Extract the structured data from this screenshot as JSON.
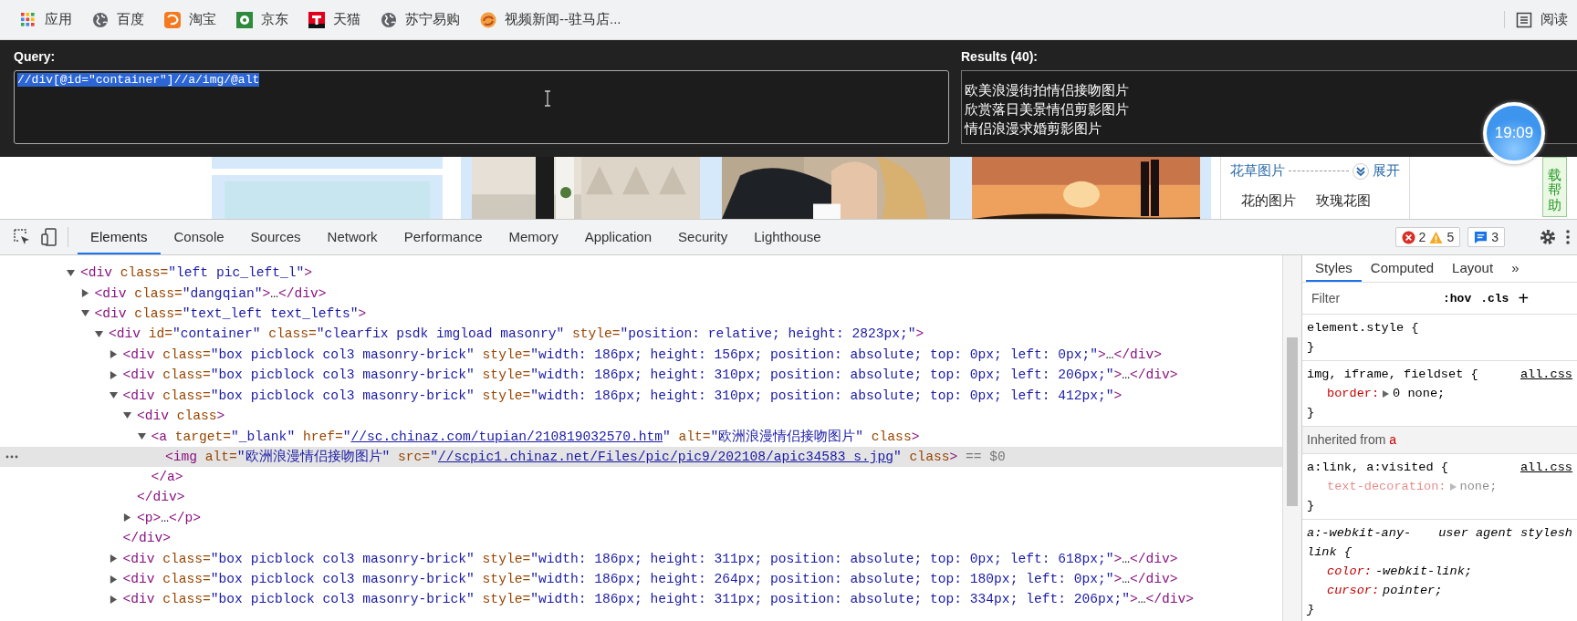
{
  "bookmarks": [
    {
      "kind": "apps",
      "label": "应用"
    },
    {
      "kind": "globe",
      "label": "百度"
    },
    {
      "kind": "taobao",
      "label": "淘宝"
    },
    {
      "kind": "jd",
      "label": "京东"
    },
    {
      "kind": "tmall",
      "label": "天猫"
    },
    {
      "kind": "globe",
      "label": "苏宁易购"
    },
    {
      "kind": "video",
      "label": "视频新闻--驻马店..."
    }
  ],
  "reading_list": {
    "label": "阅读"
  },
  "xpath_helper": {
    "query_label": "Query:",
    "query": {
      "value": "//div[@id=\"container\"]//a/img/@alt",
      "highlighted": true
    },
    "results_label": "Results (40):",
    "results": [
      "欧美浪漫街拍情侣接吻图片",
      "欣赏落日美景情侣剪影图片",
      "情侣浪漫求婚剪影图片"
    ]
  },
  "clock": "19:09",
  "page": {
    "sidebar": {
      "heading": "花草图片",
      "expand": "展开",
      "links": [
        "花的图片",
        "玫瑰花图"
      ]
    },
    "help_button": "载帮助"
  },
  "devtools": {
    "tabs": [
      {
        "label": "Elements",
        "selected": true
      },
      {
        "label": "Console",
        "selected": false
      },
      {
        "label": "Sources",
        "selected": false
      },
      {
        "label": "Network",
        "selected": false
      },
      {
        "label": "Performance",
        "selected": false
      },
      {
        "label": "Memory",
        "selected": false
      },
      {
        "label": "Application",
        "selected": false
      },
      {
        "label": "Security",
        "selected": false
      },
      {
        "label": "Lighthouse",
        "selected": false
      }
    ],
    "issues": {
      "errors": "2",
      "warnings": "5",
      "messages": "3"
    },
    "tree": [
      {
        "expanded": true,
        "selected": false,
        "line": [
          {
            "kind": "tag",
            "text": "<div"
          },
          {
            "kind": "attr",
            "text": " class="
          },
          {
            "kind": "value",
            "text": "\"left pic_left_l\""
          },
          {
            "kind": "tag",
            "text": ">"
          }
        ],
        "children": [
          {
            "expanded": false,
            "selected": false,
            "line": [
              {
                "kind": "tag",
                "text": "<div"
              },
              {
                "kind": "attr",
                "text": " class="
              },
              {
                "kind": "value",
                "text": "\"dangqian\""
              },
              {
                "kind": "tag",
                "text": ">"
              },
              {
                "kind": "plain",
                "text": "…"
              },
              {
                "kind": "tag",
                "text": "</div>"
              }
            ]
          },
          {
            "expanded": true,
            "selected": false,
            "line": [
              {
                "kind": "tag",
                "text": "<div"
              },
              {
                "kind": "attr",
                "text": " class="
              },
              {
                "kind": "value",
                "text": "\"text_left text_lefts\""
              },
              {
                "kind": "tag",
                "text": ">"
              }
            ],
            "children": [
              {
                "expanded": true,
                "selected": false,
                "line": [
                  {
                    "kind": "tag",
                    "text": "<div"
                  },
                  {
                    "kind": "attr",
                    "text": " id="
                  },
                  {
                    "kind": "value",
                    "text": "\"container\""
                  },
                  {
                    "kind": "attr",
                    "text": " class="
                  },
                  {
                    "kind": "value",
                    "text": "\"clearfix psdk imgload masonry\""
                  },
                  {
                    "kind": "attr",
                    "text": " style="
                  },
                  {
                    "kind": "value",
                    "text": "\"position: relative; height: 2823px;\""
                  },
                  {
                    "kind": "tag",
                    "text": ">"
                  }
                ],
                "children": [
                  {
                    "expanded": false,
                    "selected": false,
                    "line": [
                      {
                        "kind": "tag",
                        "text": "<div"
                      },
                      {
                        "kind": "attr",
                        "text": " class="
                      },
                      {
                        "kind": "value",
                        "text": "\"box picblock col3 masonry-brick\""
                      },
                      {
                        "kind": "attr",
                        "text": " style="
                      },
                      {
                        "kind": "value",
                        "text": "\"width: 186px; height: 156px; position: absolute; top: 0px; left: 0px;\""
                      },
                      {
                        "kind": "tag",
                        "text": ">"
                      },
                      {
                        "kind": "plain",
                        "text": "…"
                      },
                      {
                        "kind": "tag",
                        "text": "</div>"
                      }
                    ]
                  },
                  {
                    "expanded": false,
                    "selected": false,
                    "line": [
                      {
                        "kind": "tag",
                        "text": "<div"
                      },
                      {
                        "kind": "attr",
                        "text": " class="
                      },
                      {
                        "kind": "value",
                        "text": "\"box picblock col3 masonry-brick\""
                      },
                      {
                        "kind": "attr",
                        "text": " style="
                      },
                      {
                        "kind": "value",
                        "text": "\"width: 186px; height: 310px; position: absolute; top: 0px; left: 206px;\""
                      },
                      {
                        "kind": "tag",
                        "text": ">"
                      },
                      {
                        "kind": "plain",
                        "text": "…"
                      },
                      {
                        "kind": "tag",
                        "text": "</div>"
                      }
                    ]
                  },
                  {
                    "expanded": true,
                    "selected": false,
                    "line": [
                      {
                        "kind": "tag",
                        "text": "<div"
                      },
                      {
                        "kind": "attr",
                        "text": " class="
                      },
                      {
                        "kind": "value",
                        "text": "\"box picblock col3 masonry-brick\""
                      },
                      {
                        "kind": "attr",
                        "text": " style="
                      },
                      {
                        "kind": "value",
                        "text": "\"width: 186px; height: 310px; position: absolute; top: 0px; left: 412px;\""
                      },
                      {
                        "kind": "tag",
                        "text": ">"
                      }
                    ],
                    "end": [
                      {
                        "kind": "tag",
                        "text": "</div>"
                      }
                    ],
                    "children": [
                      {
                        "expanded": true,
                        "selected": false,
                        "line": [
                          {
                            "kind": "tag",
                            "text": "<div"
                          },
                          {
                            "kind": "attr",
                            "text": " class"
                          },
                          {
                            "kind": "tag",
                            "text": ">"
                          }
                        ],
                        "end": [
                          {
                            "kind": "tag",
                            "text": "</div>"
                          }
                        ],
                        "children": [
                          {
                            "expanded": true,
                            "selected": false,
                            "line": [
                              {
                                "kind": "tag",
                                "text": "<a"
                              },
                              {
                                "kind": "attr",
                                "text": " target="
                              },
                              {
                                "kind": "value",
                                "text": "\"_blank\""
                              },
                              {
                                "kind": "attr",
                                "text": " href="
                              },
                              {
                                "kind": "value",
                                "text": "\""
                              },
                              {
                                "kind": "link",
                                "text": "//sc.chinaz.com/tupian/210819032570.htm"
                              },
                              {
                                "kind": "value",
                                "text": "\""
                              },
                              {
                                "kind": "attr",
                                "text": " alt="
                              },
                              {
                                "kind": "value",
                                "text": "\"欧洲浪漫情侣接吻图片\""
                              },
                              {
                                "kind": "attr",
                                "text": " class"
                              },
                              {
                                "kind": "tag",
                                "text": ">"
                              }
                            ],
                            "end": [
                              {
                                "kind": "tag",
                                "text": "</a>"
                              }
                            ],
                            "children": [
                              {
                                "selected": true,
                                "line": [
                                  {
                                    "kind": "tag",
                                    "text": "<img"
                                  },
                                  {
                                    "kind": "attr",
                                    "text": " alt="
                                  },
                                  {
                                    "kind": "value",
                                    "text": "\"欧洲浪漫情侣接吻图片\""
                                  },
                                  {
                                    "kind": "attr",
                                    "text": " src="
                                  },
                                  {
                                    "kind": "value",
                                    "text": "\""
                                  },
                                  {
                                    "kind": "link",
                                    "text": "//scpic1.chinaz.net/Files/pic/pic9/202108/apic34583_s.jpg"
                                  },
                                  {
                                    "kind": "value",
                                    "text": "\""
                                  },
                                  {
                                    "kind": "attr",
                                    "text": " class"
                                  },
                                  {
                                    "kind": "tag",
                                    "text": ">"
                                  },
                                  {
                                    "kind": "muted",
                                    "text": " == $0"
                                  }
                                ]
                              }
                            ]
                          }
                        ]
                      },
                      {
                        "expanded": false,
                        "selected": false,
                        "line": [
                          {
                            "kind": "tag",
                            "text": "<p>"
                          },
                          {
                            "kind": "plain",
                            "text": "…"
                          },
                          {
                            "kind": "tag",
                            "text": "</p>"
                          }
                        ]
                      }
                    ]
                  },
                  {
                    "expanded": false,
                    "selected": false,
                    "line": [
                      {
                        "kind": "tag",
                        "text": "<div"
                      },
                      {
                        "kind": "attr",
                        "text": " class="
                      },
                      {
                        "kind": "value",
                        "text": "\"box picblock col3 masonry-brick\""
                      },
                      {
                        "kind": "attr",
                        "text": " style="
                      },
                      {
                        "kind": "value",
                        "text": "\"width: 186px; height: 311px; position: absolute; top: 0px; left: 618px;\""
                      },
                      {
                        "kind": "tag",
                        "text": ">"
                      },
                      {
                        "kind": "plain",
                        "text": "…"
                      },
                      {
                        "kind": "tag",
                        "text": "</div>"
                      }
                    ]
                  },
                  {
                    "expanded": false,
                    "selected": false,
                    "line": [
                      {
                        "kind": "tag",
                        "text": "<div"
                      },
                      {
                        "kind": "attr",
                        "text": " class="
                      },
                      {
                        "kind": "value",
                        "text": "\"box picblock col3 masonry-brick\""
                      },
                      {
                        "kind": "attr",
                        "text": " style="
                      },
                      {
                        "kind": "value",
                        "text": "\"width: 186px; height: 264px; position: absolute; top: 180px; left: 0px;\""
                      },
                      {
                        "kind": "tag",
                        "text": ">"
                      },
                      {
                        "kind": "plain",
                        "text": "…"
                      },
                      {
                        "kind": "tag",
                        "text": "</div>"
                      }
                    ]
                  },
                  {
                    "expanded": false,
                    "selected": false,
                    "line": [
                      {
                        "kind": "tag",
                        "text": "<div"
                      },
                      {
                        "kind": "attr",
                        "text": " class="
                      },
                      {
                        "kind": "value",
                        "text": "\"box picblock col3 masonry-brick\""
                      },
                      {
                        "kind": "attr",
                        "text": " style="
                      },
                      {
                        "kind": "value",
                        "text": "\"width: 186px; height: 311px; position: absolute; top: 334px; left: 206px;\""
                      },
                      {
                        "kind": "tag",
                        "text": ">"
                      },
                      {
                        "kind": "plain",
                        "text": "…"
                      },
                      {
                        "kind": "tag",
                        "text": "</div>"
                      }
                    ]
                  }
                ]
              }
            ]
          }
        ]
      }
    ],
    "styles": {
      "tabs": [
        {
          "label": "Styles",
          "selected": true
        },
        {
          "label": "Computed",
          "selected": false
        },
        {
          "label": "Layout",
          "selected": false
        },
        {
          "label": "»",
          "selected": false
        }
      ],
      "filter_placeholder": "Filter",
      "hov": ":hov",
      "cls": ".cls",
      "add": "+",
      "sections": [
        {
          "kind": "rule",
          "user_agent": false,
          "selector": "element.style {",
          "close": "}"
        },
        {
          "kind": "rule",
          "user_agent": false,
          "selector": "img, iframe, fieldset {",
          "source": "all.css",
          "close": "}",
          "declarations": [
            {
              "name": "border:",
              "value": "0 none;",
              "expandable": true,
              "overridden": false
            }
          ]
        },
        {
          "kind": "inherited",
          "text": "Inherited from",
          "element": "a"
        },
        {
          "kind": "rule",
          "user_agent": false,
          "selector": "a:link, a:visited {",
          "source": "all.css",
          "close": "}",
          "declarations": [
            {
              "name": "text-decoration:",
              "value": "none;",
              "expandable": true,
              "overridden": true
            }
          ]
        },
        {
          "kind": "rule",
          "user_agent": true,
          "selector": "a:-webkit-any-link {",
          "source": "user agent stylesh",
          "close": "}",
          "declarations": [
            {
              "name": "color:",
              "value": "-webkit-link;",
              "expandable": false,
              "overridden": false
            },
            {
              "name": "cursor:",
              "value": "pointer;",
              "expandable": false,
              "overridden": false
            }
          ]
        }
      ]
    }
  }
}
